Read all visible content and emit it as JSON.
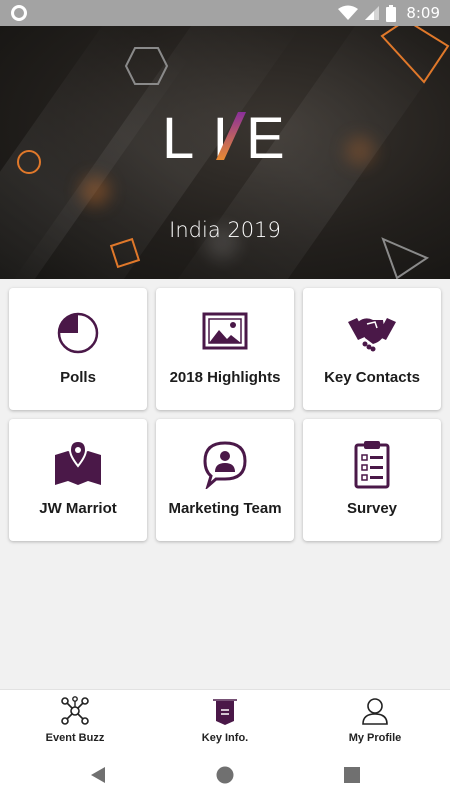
{
  "status_bar": {
    "time": "8:09"
  },
  "hero": {
    "logo_text": "LIVE",
    "subtitle": "India 2019"
  },
  "tiles": [
    {
      "label": "Polls",
      "icon": "pie-chart-icon"
    },
    {
      "label": "2018 Highlights",
      "icon": "image-gallery-icon"
    },
    {
      "label": "Key Contacts",
      "icon": "handshake-icon"
    },
    {
      "label": "JW Marriot",
      "icon": "map-pin-icon"
    },
    {
      "label": "Marketing Team",
      "icon": "chat-person-icon"
    },
    {
      "label": "Survey",
      "icon": "clipboard-checklist-icon"
    }
  ],
  "bottom_nav": [
    {
      "label": "Event Buzz",
      "icon": "network-icon"
    },
    {
      "label": "Key Info.",
      "icon": "info-banner-icon"
    },
    {
      "label": "My Profile",
      "icon": "user-icon"
    }
  ],
  "colors": {
    "accent": "#4a1848",
    "orange": "#e0782a",
    "purple": "#7b2a86"
  }
}
